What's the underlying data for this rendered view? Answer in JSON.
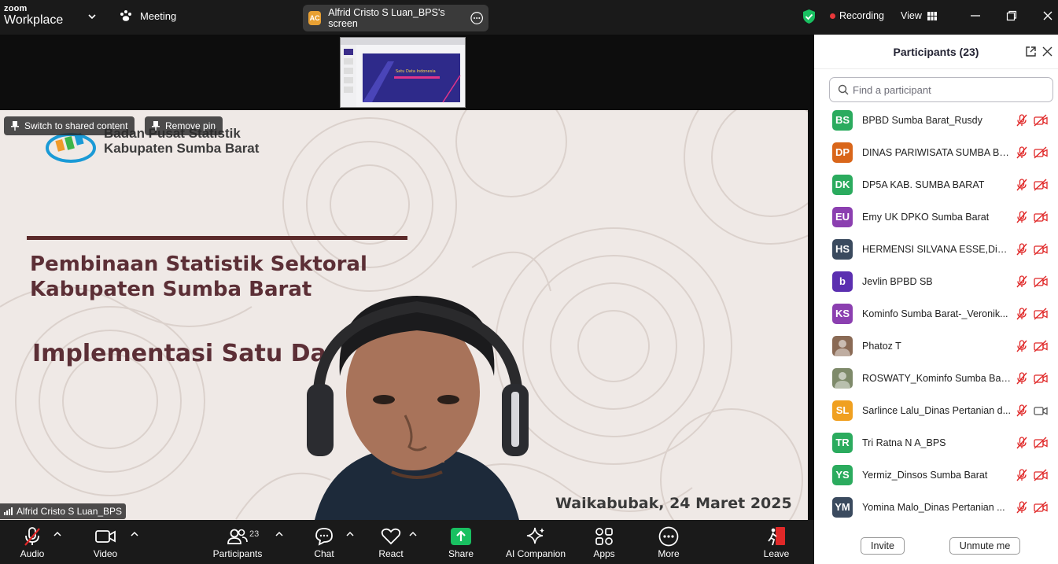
{
  "app": {
    "logo_line1": "zoom",
    "logo_line2": "Workplace"
  },
  "titlebar": {
    "meeting_label": "Meeting",
    "share_avatar": "AC",
    "share_label": "Alfrid Cristo S Luan_BPS's screen",
    "recording_label": "Recording",
    "view_label": "View"
  },
  "stage": {
    "switch_label": "Switch to shared content",
    "remove_pin_label": "Remove pin",
    "speaker_name": "Alfrid Cristo S Luan_BPS",
    "thumbnail_title": "Satu Data Indonesia",
    "slide": {
      "org_line1": "Badan Pusat Statistik",
      "org_line2": "Kabupaten Sumba Barat",
      "heading_line1": "Pembinaan Statistik Sektoral",
      "heading_line2": "Kabupaten Sumba Barat",
      "subheading": "Implementasi Satu Da",
      "date": "Waikabubak, 24 Maret 2025"
    }
  },
  "toolbar": {
    "audio": "Audio",
    "video": "Video",
    "participants": "Participants",
    "participants_count": "23",
    "chat": "Chat",
    "react": "React",
    "share": "Share",
    "ai_companion": "AI Companion",
    "apps": "Apps",
    "more": "More",
    "leave": "Leave"
  },
  "panel": {
    "title": "Participants (23)",
    "search_placeholder": "Find a participant",
    "invite": "Invite",
    "unmute_me": "Unmute me",
    "participants": [
      {
        "initials": "BS",
        "name": "BPBD Sumba Barat_Rusdy",
        "color": "#2bab5e",
        "camera": "off"
      },
      {
        "initials": "DP",
        "name": "DINAS PARIWISATA SUMBA BA...",
        "color": "#d9661a",
        "camera": "off"
      },
      {
        "initials": "DK",
        "name": "DP5A KAB. SUMBA BARAT",
        "color": "#2bab5e",
        "camera": "off"
      },
      {
        "initials": "EU",
        "name": "Emy UK DPKO Sumba Barat",
        "color": "#8b3fb0",
        "camera": "off"
      },
      {
        "initials": "HS",
        "name": "HERMENSI SILVANA ESSE,Disna...",
        "color": "#3a4a5e",
        "camera": "off"
      },
      {
        "initials": "b",
        "name": "Jevlin BPBD SB",
        "color": "#5b2fb0",
        "camera": "off"
      },
      {
        "initials": "KS",
        "name": "Kominfo Sumba Barat-_Veronik...",
        "color": "#8b3fb0",
        "camera": "off"
      },
      {
        "initials": "",
        "name": "Phatoz T",
        "color": "#8a6a55",
        "camera": "off"
      },
      {
        "initials": "",
        "name": "ROSWATY_Kominfo Sumba Barat",
        "color": "#7e8a6a",
        "camera": "off"
      },
      {
        "initials": "SL",
        "name": "Sarlince Lalu_Dinas Pertanian d...",
        "color": "#f0a020",
        "camera": "on"
      },
      {
        "initials": "TR",
        "name": "Tri Ratna N A_BPS",
        "color": "#2bab5e",
        "camera": "off"
      },
      {
        "initials": "YS",
        "name": "Yermiz_Dinsos Sumba Barat",
        "color": "#2bab5e",
        "camera": "off"
      },
      {
        "initials": "YM",
        "name": "Yomina Malo_Dinas Pertanian ...",
        "color": "#3a4a5e",
        "camera": "off"
      }
    ]
  },
  "colors": {
    "accent_green": "#19c061",
    "recording_red": "#e8383a",
    "leave_red": "#e02828",
    "slide_text": "#5c2f36"
  }
}
